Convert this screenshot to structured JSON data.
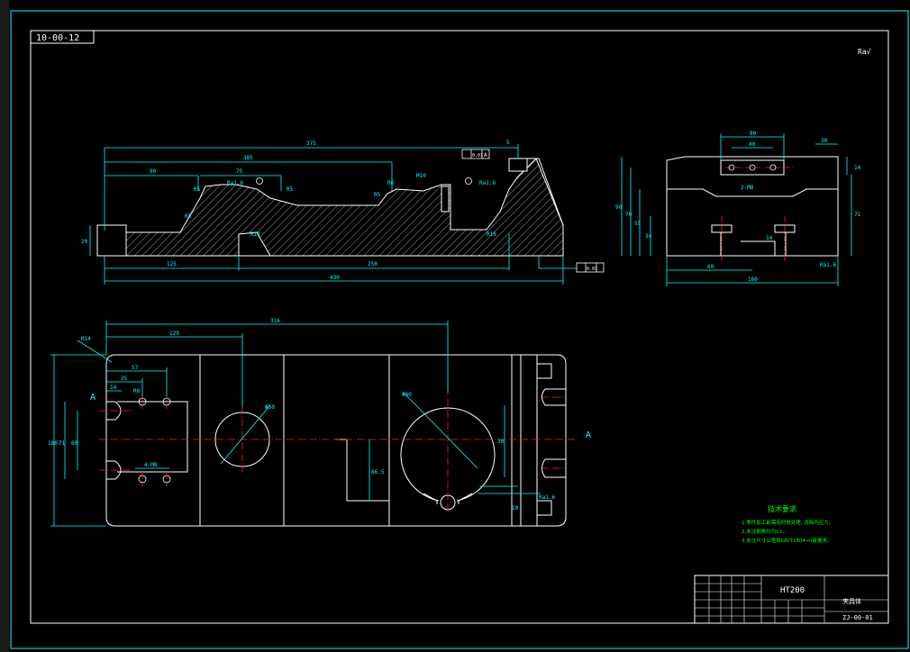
{
  "colors": {
    "background": "#000000",
    "outline": "#ffffff",
    "dimension": "#00ffff",
    "hatch": "#ffffff",
    "centerline": "#ff2020",
    "notes": "#00ff00",
    "frame_left": "#808080"
  },
  "drawing": {
    "code_box": "10-00-12",
    "roughness_top_right": "Ra√",
    "notes_title": "技术要求",
    "notes_lines": [
      "1.零件加工前需有时效处理, 消除内应力。",
      "2.未注倒角均为C1。",
      "3.未注尺寸公差按GB/T1804-m级要求。"
    ],
    "title_block": {
      "material": "HT200",
      "part_name": "夹具体",
      "drawing_no": "ZJ-00-01"
    }
  },
  "front_view": {
    "dims": {
      "overall_375": "375",
      "d_385": "385",
      "d_90": "90",
      "d_75": "75",
      "d_125": "125",
      "d_250": "250",
      "d_430": "430",
      "d_20": "20",
      "d_5": "5",
      "r5a": "R5",
      "r5b": "R5",
      "r5c": "R5",
      "r5d": "R5",
      "r10": "R10",
      "r10b": "R10",
      "r6": "R6",
      "ra_a": "Ra1.6",
      "ra_b": "Ra1.6",
      "m10": "M10",
      "tol_a": "0.01",
      "tol_b": "0.01",
      "datum_a": "A"
    }
  },
  "side_view": {
    "dims": {
      "d_80": "80",
      "d_40": "40",
      "d_30": "30",
      "d_14": "14",
      "d_90": "90",
      "d_70": "70",
      "d_55": "55",
      "d_34": "34",
      "d_71": "71",
      "d_60": "60",
      "d_160": "160",
      "d_14b": "14",
      "hole": "2-M8",
      "ra": "Ra1.6"
    }
  },
  "top_view": {
    "dims": {
      "d_316": "316",
      "d_129": "129",
      "d_57": "57",
      "d_35": "35",
      "d_14": "14",
      "d_180": "180",
      "d_71": "71",
      "d_60": "60",
      "d_86": "86.5",
      "d_10": "10",
      "d_r6": "R6",
      "r_a": "R14",
      "phi50": "Φ50",
      "phi80": "Φ80",
      "d_30": "30",
      "ra": "Ra1.6",
      "hole_label": "4-M8",
      "section_a_left": "A",
      "section_a_right": "A"
    }
  }
}
